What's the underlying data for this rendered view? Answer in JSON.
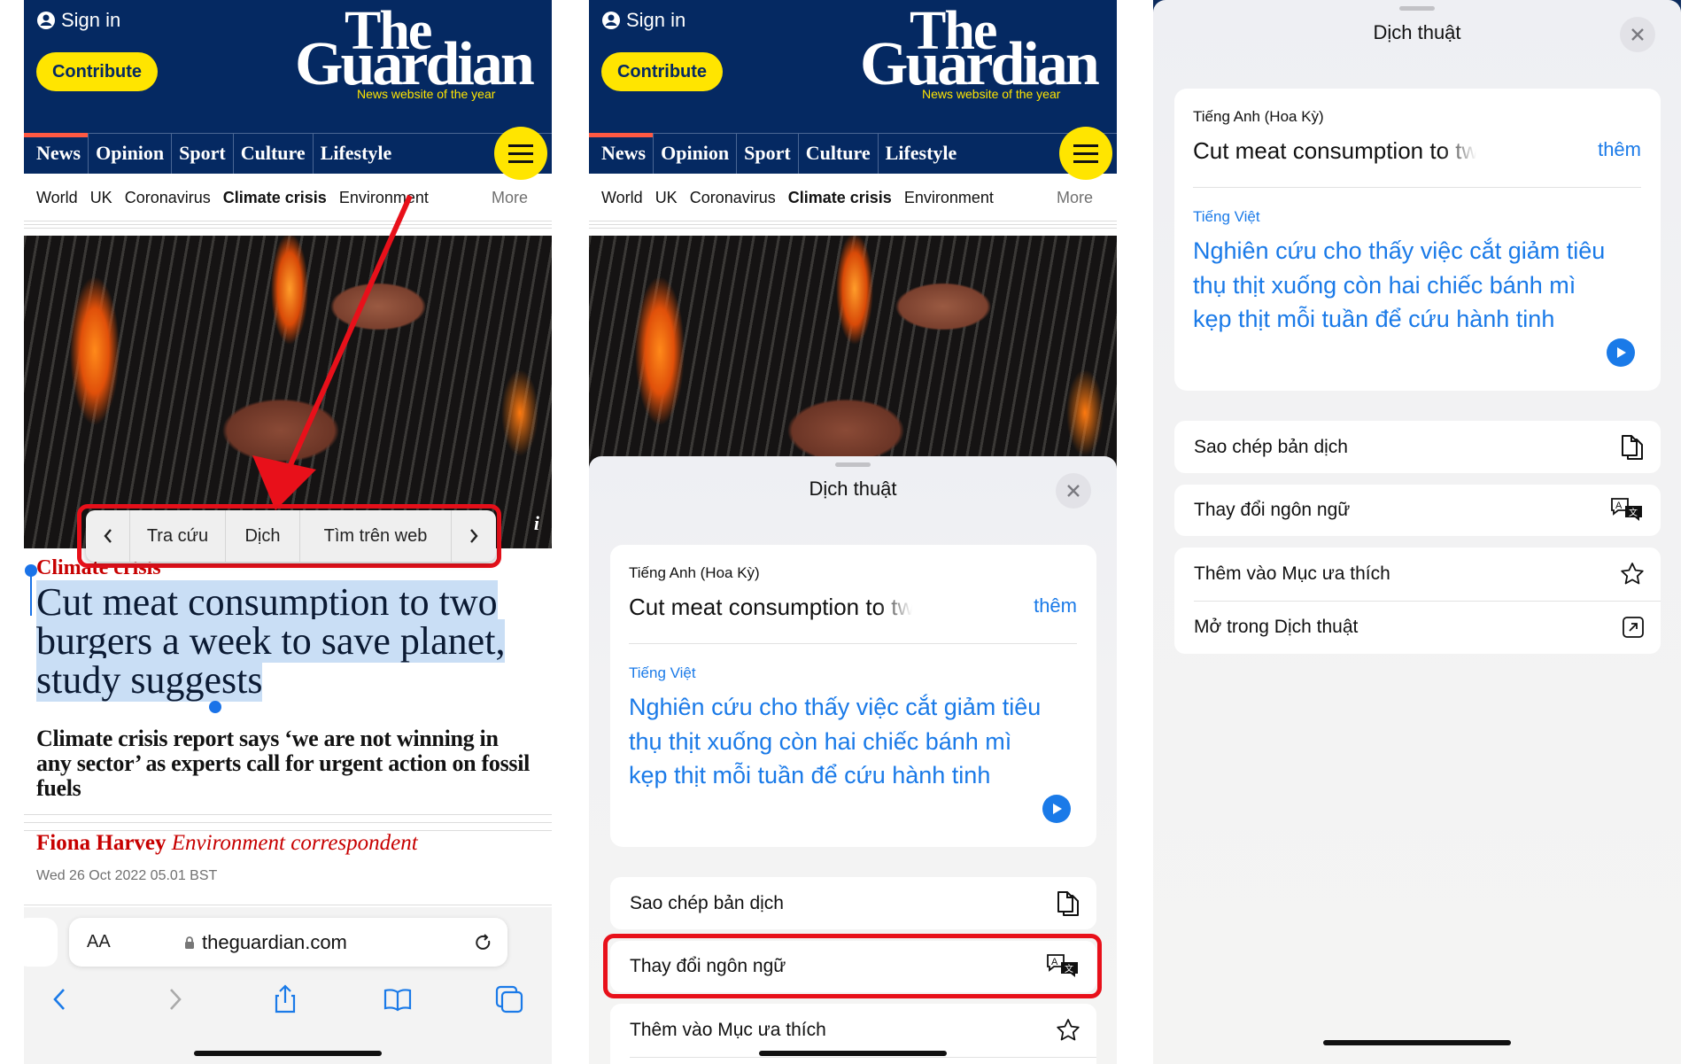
{
  "header": {
    "sign_in": "Sign in",
    "contribute": "Contribute",
    "logo_the": "The",
    "logo_guardian": "Guardian",
    "tagline": "News website of the year",
    "nav": [
      "News",
      "Opinion",
      "Sport",
      "Culture",
      "Lifestyle"
    ],
    "subnav": [
      "World",
      "UK",
      "Coronavirus",
      "Climate crisis",
      "Environment"
    ],
    "more": "More"
  },
  "article": {
    "kicker": "Climate crisis",
    "headline": "Cut meat consumption to two burgers a week to save planet, study suggests",
    "standfirst": "Climate crisis report says ‘we are not winning in any sector’ as experts call for urgent action on fossil fuels",
    "author": "Fiona Harvey",
    "role": "Environment correspondent",
    "date": "Wed 26 Oct 2022 05.01 BST",
    "image_info": "i"
  },
  "context_menu": {
    "items": [
      "Tra cứu",
      "Dịch",
      "Tìm trên web"
    ]
  },
  "browser": {
    "text_size": "AA",
    "url": "theguardian.com"
  },
  "translate": {
    "title": "Dịch thuật",
    "source_lang": "Tiếng Anh (Hoa Kỳ)",
    "source_text": "Cut meat consumption to two bur",
    "more": "thêm",
    "target_lang": "Tiếng Việt",
    "target_text": "Nghiên cứu cho thấy việc cắt giảm tiêu thụ thịt xuống còn hai chiếc bánh mì kẹp thịt mỗi tuần để cứu hành tinh",
    "actions": [
      "Sao chép bản dịch",
      "Thay đổi ngôn ngữ",
      "Thêm vào Mục ưa thích",
      "Mở trong Dịch thuật"
    ]
  },
  "colors": {
    "guardian_navy": "#052962",
    "guardian_yellow": "#ffe500",
    "guardian_red": "#c70000",
    "ios_blue": "#1a7ae8",
    "annotation_red": "#e8101a"
  }
}
